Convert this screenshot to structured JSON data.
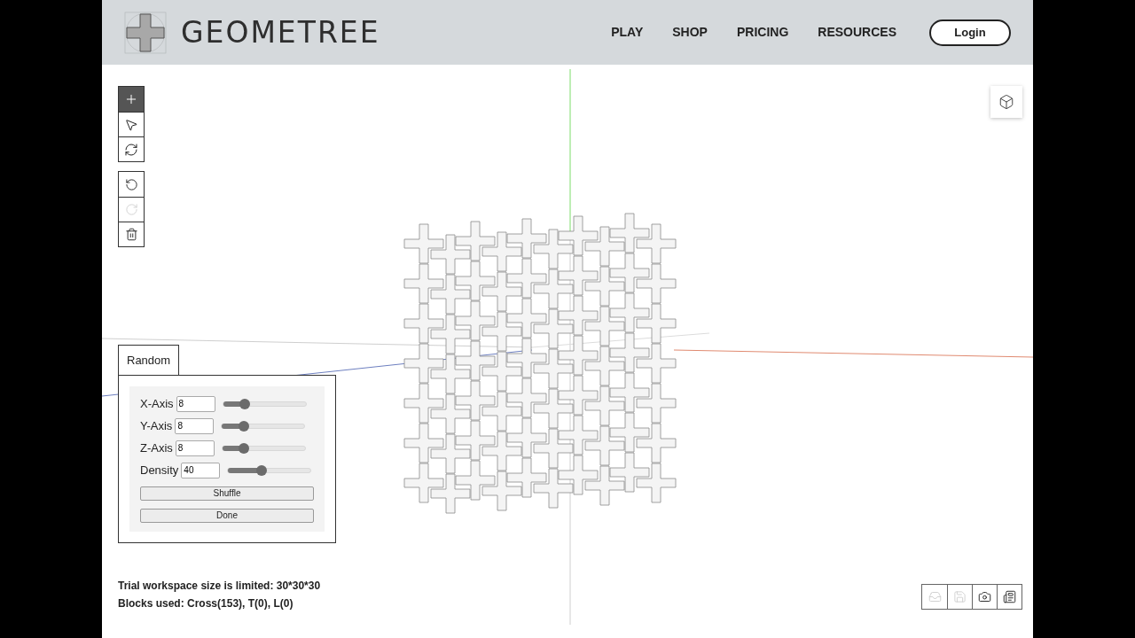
{
  "brand": {
    "name": "GEOMETREE"
  },
  "nav": [
    {
      "label": "PLAY"
    },
    {
      "label": "SHOP"
    },
    {
      "label": "PRICING"
    },
    {
      "label": "RESOURCES"
    }
  ],
  "login": {
    "label": "Login"
  },
  "tools": [
    {
      "kind": "add",
      "selected": true
    },
    {
      "kind": "select",
      "selected": false
    },
    {
      "kind": "rotate",
      "selected": false
    }
  ],
  "history": [
    {
      "kind": "undo",
      "disabled": false
    },
    {
      "kind": "redo",
      "disabled": true
    },
    {
      "kind": "delete",
      "disabled": false
    }
  ],
  "random_panel": {
    "tab": "Random",
    "axes": [
      {
        "label": "X-Axis",
        "value": "8",
        "level": 0.26
      },
      {
        "label": "Y-Axis",
        "value": "8",
        "level": 0.26
      },
      {
        "label": "Z-Axis",
        "value": "8",
        "level": 0.26
      },
      {
        "label": "Density",
        "value": "40",
        "level": 0.4
      }
    ],
    "buttons": [
      "Shuffle",
      "Done"
    ]
  },
  "status": [
    "Trial workspace size is limited: 30*30*30",
    "Blocks used: Cross(153), T(0), L(0)"
  ],
  "bottom_tools": [
    {
      "kind": "open",
      "disabled": true
    },
    {
      "kind": "save",
      "disabled": true
    },
    {
      "kind": "camera",
      "disabled": false
    },
    {
      "kind": "report",
      "disabled": false
    }
  ]
}
